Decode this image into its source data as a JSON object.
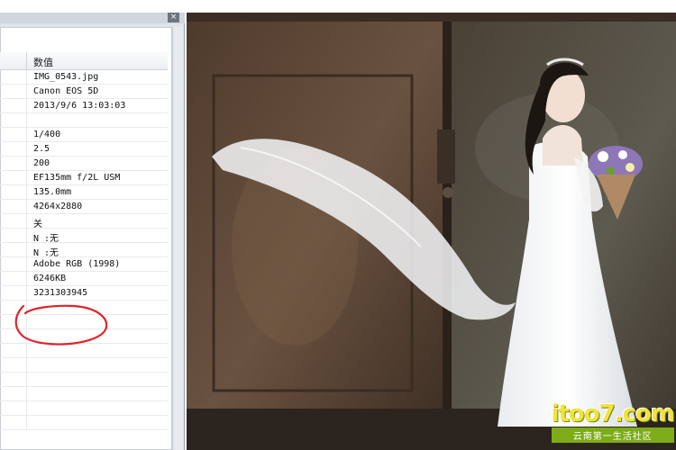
{
  "window": {
    "close_glyph": "×"
  },
  "exif_table": {
    "value_header": "数值",
    "rows": [
      {
        "value": "IMG_0543.jpg"
      },
      {
        "value": "Canon EOS 5D"
      },
      {
        "value": "2013/9/6 13:03:03"
      },
      {
        "value": ""
      },
      {
        "value": "1/400"
      },
      {
        "value": "2.5"
      },
      {
        "value": "200"
      },
      {
        "value": "EF135mm f/2L USM"
      },
      {
        "value": "135.0mm"
      },
      {
        "value": "4264x2880"
      },
      {
        "value": "关"
      },
      {
        "value": "N :无"
      },
      {
        "value": "N :无"
      },
      {
        "value": "Adobe RGB (1998)"
      },
      {
        "value": "6246KB"
      },
      {
        "value": "3231303945"
      },
      {
        "value": ""
      },
      {
        "value": ""
      },
      {
        "value": ""
      },
      {
        "value": ""
      },
      {
        "value": ""
      },
      {
        "value": ""
      },
      {
        "value": ""
      },
      {
        "value": ""
      },
      {
        "value": ""
      }
    ]
  },
  "annotation": {
    "color": "#e0242b"
  },
  "watermark": {
    "logo": "itoo7.com",
    "subtitle": "云南第一生活社区"
  },
  "icons": {
    "close": "close-icon"
  }
}
